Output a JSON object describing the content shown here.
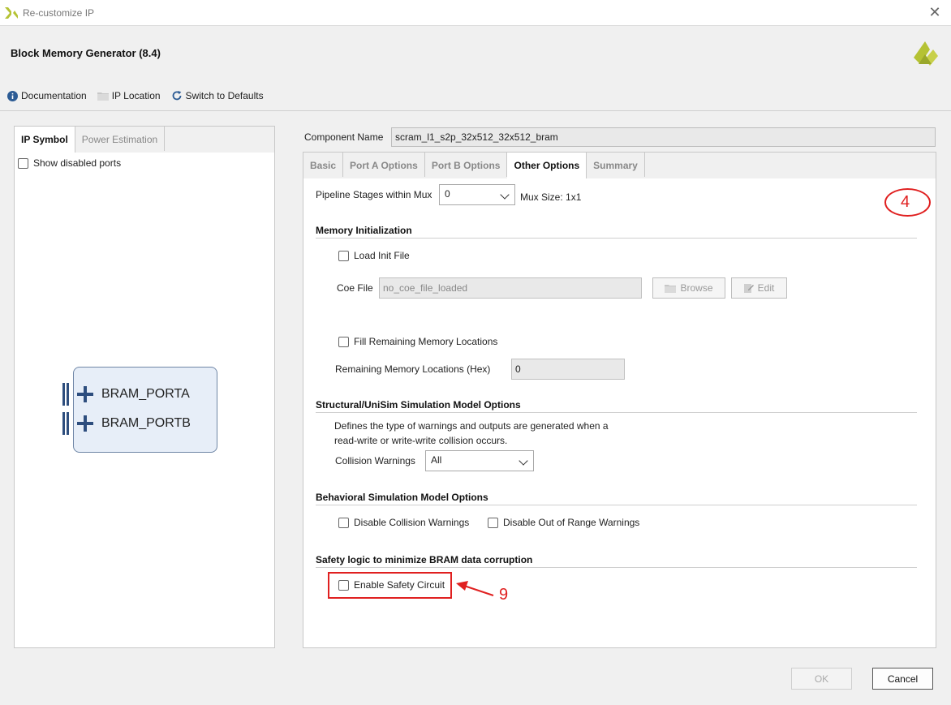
{
  "window": {
    "title": "Re-customize IP"
  },
  "header": {
    "ip_name": "Block Memory Generator (8.4)"
  },
  "toolbar": {
    "documentation": "Documentation",
    "ip_location": "IP Location",
    "switch_defaults": "Switch to Defaults"
  },
  "left": {
    "tabs": [
      "IP Symbol",
      "Power Estimation"
    ],
    "show_disabled_ports": "Show disabled ports",
    "ports": [
      "BRAM_PORTA",
      "BRAM_PORTB"
    ]
  },
  "component": {
    "label": "Component Name",
    "value": "scram_l1_s2p_32x512_32x512_bram"
  },
  "tabs": [
    "Basic",
    "Port A Options",
    "Port B Options",
    "Other Options",
    "Summary"
  ],
  "pipeline": {
    "label": "Pipeline Stages within Mux",
    "value": "0",
    "mux_size": "Mux Size: 1x1"
  },
  "mem_init": {
    "heading": "Memory Initialization",
    "load_init": "Load Init File",
    "coe_label": "Coe File",
    "coe_value": "no_coe_file_loaded",
    "browse": "Browse",
    "edit": "Edit",
    "fill_remaining": "Fill Remaining Memory Locations",
    "remaining_label": "Remaining Memory Locations (Hex)",
    "remaining_value": "0"
  },
  "structural": {
    "heading": "Structural/UniSim Simulation Model Options",
    "desc_line1": "Defines the type of warnings and outputs are generated when a",
    "desc_line2": "read-write or write-write collision occurs.",
    "collision_label": "Collision Warnings",
    "collision_value": "All"
  },
  "behavioral": {
    "heading": "Behavioral Simulation Model Options",
    "disable_collision": "Disable Collision Warnings",
    "disable_range": "Disable Out of Range Warnings"
  },
  "safety": {
    "heading": "Safety logic to minimize BRAM data corruption",
    "enable": "Enable Safety Circuit"
  },
  "annotations": {
    "circle_label": "4",
    "arrow_label": "9",
    "color": "#e02020"
  },
  "footer": {
    "ok": "OK",
    "cancel": "Cancel"
  }
}
